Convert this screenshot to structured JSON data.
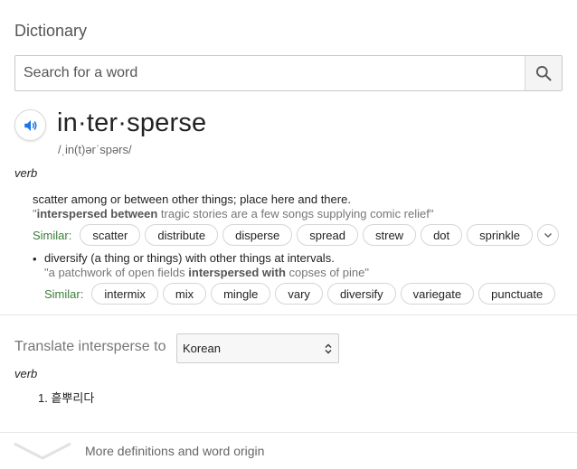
{
  "title": "Dictionary",
  "search": {
    "placeholder": "Search for a word"
  },
  "entry": {
    "headword": "in·ter·sperse",
    "pronunciation": "/ˌin(t)ərˈspərs/",
    "pos": "verb",
    "senses": [
      {
        "definition": "scatter among or between other things; place here and there.",
        "example_quote_open": "\"",
        "example_bold": "interspersed between",
        "example_rest": " tragic stories are a few songs supplying comic relief\"",
        "similar_label": "Similar:",
        "similar": [
          "scatter",
          "distribute",
          "disperse",
          "spread",
          "strew",
          "dot",
          "sprinkle"
        ]
      },
      {
        "bullet": "•",
        "definition": "diversify (a thing or things) with other things at intervals.",
        "example_pre": "\"a patchwork of open fields ",
        "example_bold": "interspersed with",
        "example_rest": " copses of pine\"",
        "similar_label": "Similar:",
        "similar": [
          "intermix",
          "mix",
          "mingle",
          "vary",
          "diversify",
          "variegate",
          "punctuate"
        ]
      }
    ]
  },
  "translate": {
    "label": "Translate intersperse to",
    "language": "Korean",
    "pos": "verb",
    "items": [
      "1. 흩뿌리다"
    ]
  },
  "footer": {
    "more_label": "More definitions and word origin"
  },
  "colors": {
    "similar_label": "#3b7e3a",
    "speaker_icon": "#1a73e8"
  },
  "icons": [
    "search-icon",
    "speaker-icon",
    "chevron-down-icon",
    "select-arrows-icon"
  ]
}
